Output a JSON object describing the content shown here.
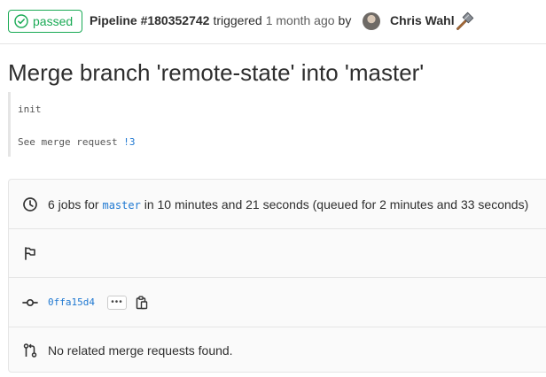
{
  "header": {
    "status_label": "passed",
    "pipeline_label": "Pipeline #180352742",
    "triggered_text": "triggered",
    "time_ago": "1 month ago",
    "by_text": "by",
    "author_name": "Chris Wahl"
  },
  "commit": {
    "title": "Merge branch 'remote-state' into 'master'",
    "description_line1": "init",
    "description_line2_prefix": "See merge request ",
    "merge_request_link": "!3"
  },
  "info": {
    "jobs_prefix": "6 jobs for ",
    "branch": "master",
    "jobs_suffix": " in 10 minutes and 21 seconds (queued for 2 minutes and 33 seconds)",
    "sha": "0ffa15d4",
    "more_label": "•••",
    "merge_requests_text": "No related merge requests found."
  },
  "colors": {
    "success": "#1aaa55",
    "link": "#1f78d1"
  },
  "icons": {
    "status": "check-circle-icon",
    "clock": "clock-icon",
    "flag": "flag-icon",
    "commit": "commit-icon",
    "clipboard": "clipboard-icon",
    "merge_request": "merge-request-icon",
    "hammer": "hammer-emoji-icon"
  }
}
